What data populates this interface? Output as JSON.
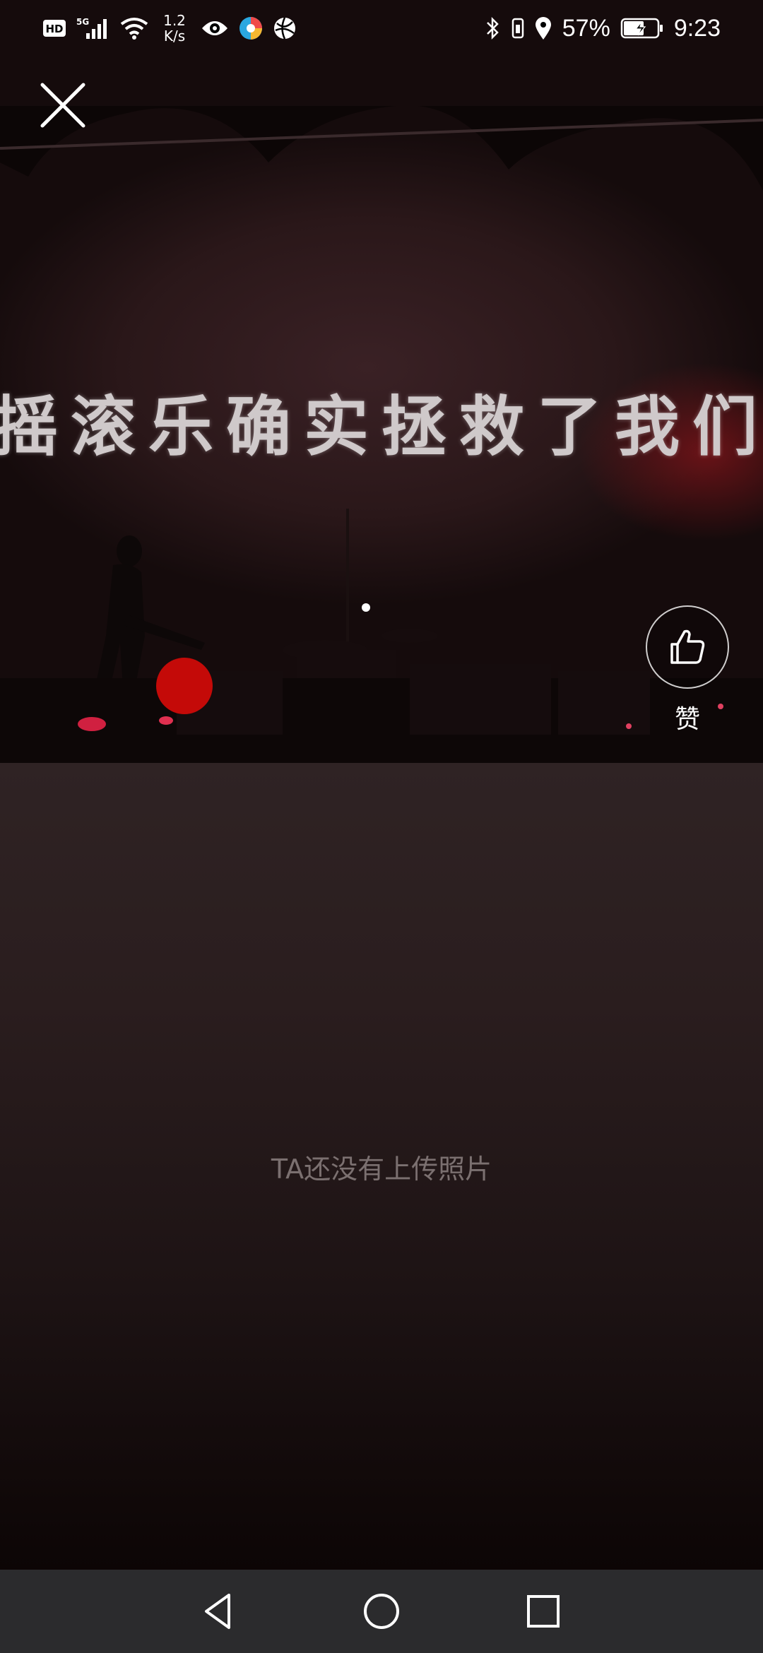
{
  "status_bar": {
    "hd_label": "HD",
    "network_type": "5G",
    "net_speed_value": "1.2",
    "net_speed_unit": "K/s",
    "battery_percent": "57%",
    "time": "9:23"
  },
  "hero": {
    "banner_text": "摇滚乐确实拯救了我们"
  },
  "like": {
    "label": "赞"
  },
  "photos": {
    "empty_message": "TA还没有上传照片"
  },
  "icons": {
    "close": "close-icon",
    "like": "thumbs-up-icon",
    "nav_back": "triangle-back-icon",
    "nav_home": "circle-home-icon",
    "nav_recent": "square-recents-icon"
  },
  "colors": {
    "record_dot": "#c40a08",
    "nav_bar": "#2b2b2d",
    "empty_text": "#7b7070"
  }
}
